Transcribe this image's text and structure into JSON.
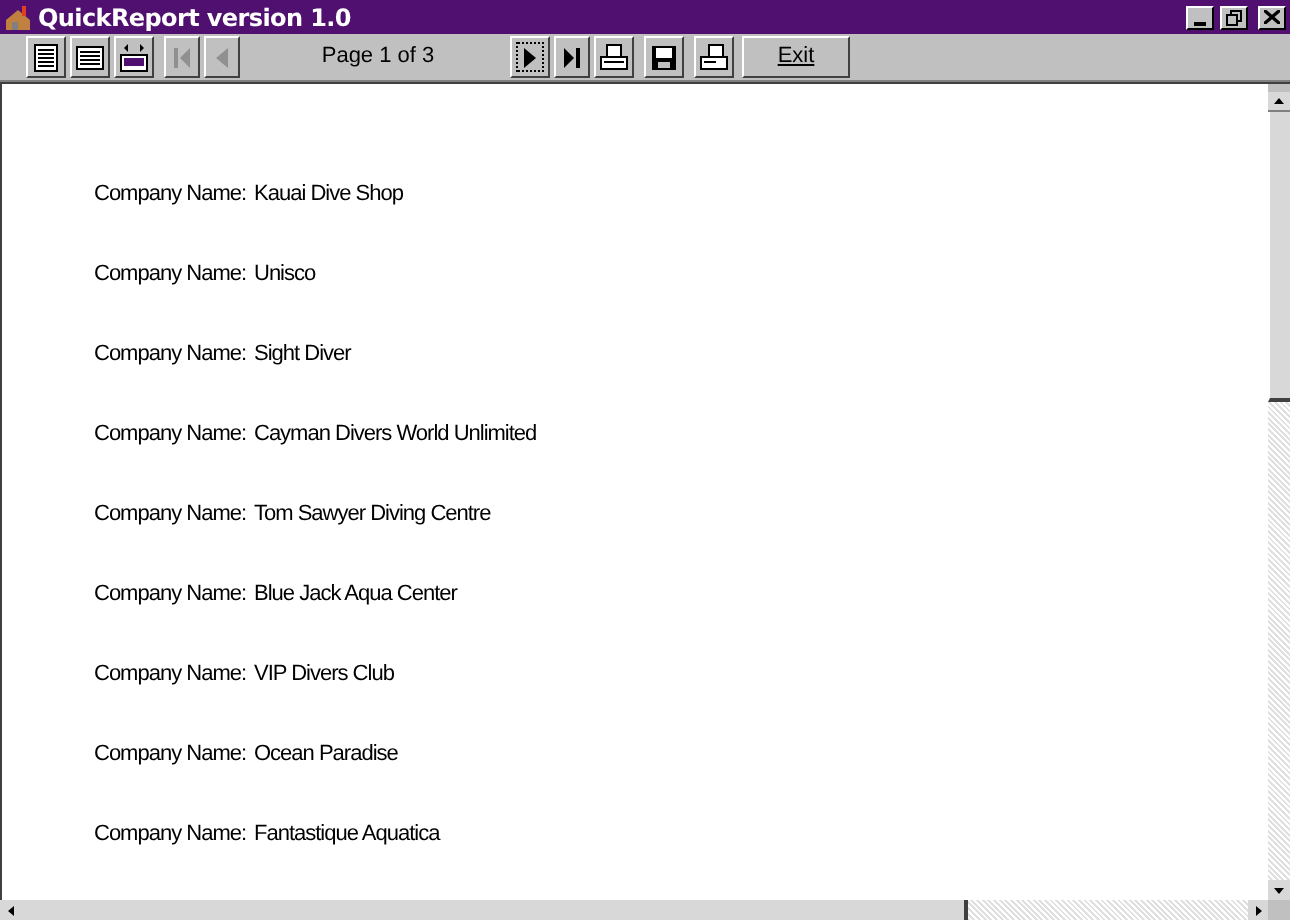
{
  "window": {
    "title": "QuickReport version 1.0"
  },
  "toolbar": [
    {
      "kind": "whole-page",
      "disabled": false
    },
    {
      "kind": "page-width",
      "disabled": false
    },
    {
      "kind": "zoom-100",
      "disabled": false
    },
    {
      "kind": "first",
      "disabled": true
    },
    {
      "kind": "prev",
      "disabled": true
    },
    {
      "kind": "label",
      "text": "Page 1 of 3"
    },
    {
      "kind": "next",
      "disabled": false,
      "focused": true
    },
    {
      "kind": "last",
      "disabled": false
    },
    {
      "kind": "print",
      "disabled": false
    },
    {
      "kind": "save",
      "disabled": false
    },
    {
      "kind": "setup",
      "disabled": false
    },
    {
      "kind": "exit",
      "label": "Exit"
    }
  ],
  "report": {
    "rows": [
      {
        "label": "Company Name:",
        "value": "Kauai Dive Shop"
      },
      {
        "label": "Company Name:",
        "value": "Unisco"
      },
      {
        "label": "Company Name:",
        "value": "Sight Diver"
      },
      {
        "label": "Company Name:",
        "value": "Cayman Divers World Unlimited"
      },
      {
        "label": "Company Name:",
        "value": "Tom Sawyer Diving Centre"
      },
      {
        "label": "Company Name:",
        "value": "Blue Jack Aqua Center"
      },
      {
        "label": "Company Name:",
        "value": "VIP Divers Club"
      },
      {
        "label": "Company Name:",
        "value": "Ocean Paradise"
      },
      {
        "label": "Company Name:",
        "value": "Fantastique Aquatica"
      }
    ]
  }
}
